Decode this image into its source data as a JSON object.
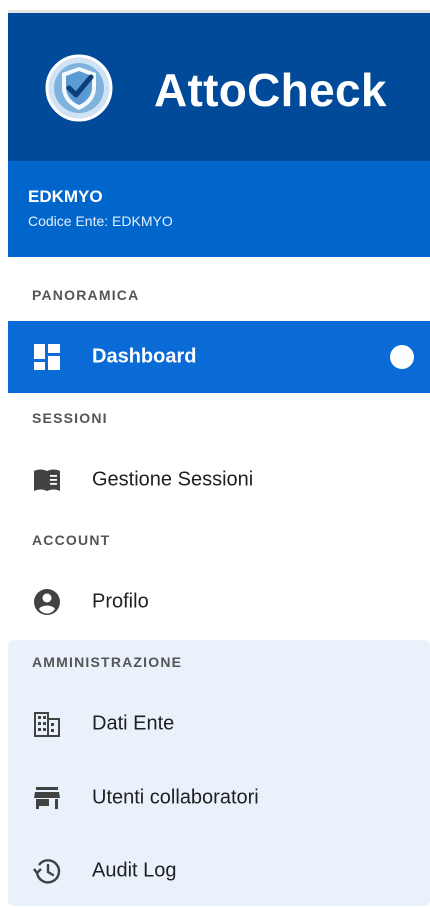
{
  "brand": {
    "title": "AttoCheck",
    "logo_icon": "shield-check-icon",
    "bg_color": "#004a99"
  },
  "entity": {
    "name": "EDKMYO",
    "code_line": "Codice Ente: EDKMYO",
    "bg_color": "#0066cc"
  },
  "sections": {
    "panoramica": "PANORAMICA",
    "sessioni": "SESSIONI",
    "account": "ACCOUNT",
    "amministrazione": "AMMINISTRAZIONE"
  },
  "nav": {
    "dashboard": {
      "label": "Dashboard",
      "icon": "dashboard-icon",
      "active": true
    },
    "gestione_sessioni": {
      "label": "Gestione Sessioni",
      "icon": "book-icon"
    },
    "profilo": {
      "label": "Profilo",
      "icon": "account-circle-icon"
    },
    "dati_ente": {
      "label": "Dati Ente",
      "icon": "building-icon"
    },
    "utenti_collaboratori": {
      "label": "Utenti collaboratori",
      "icon": "store-icon"
    },
    "audit_log": {
      "label": "Audit Log",
      "icon": "history-icon"
    }
  },
  "colors": {
    "active_bg": "#0a6bd6",
    "admin_bg": "#e9f2fb",
    "text": "#1f1f1f",
    "section": "#555555"
  }
}
